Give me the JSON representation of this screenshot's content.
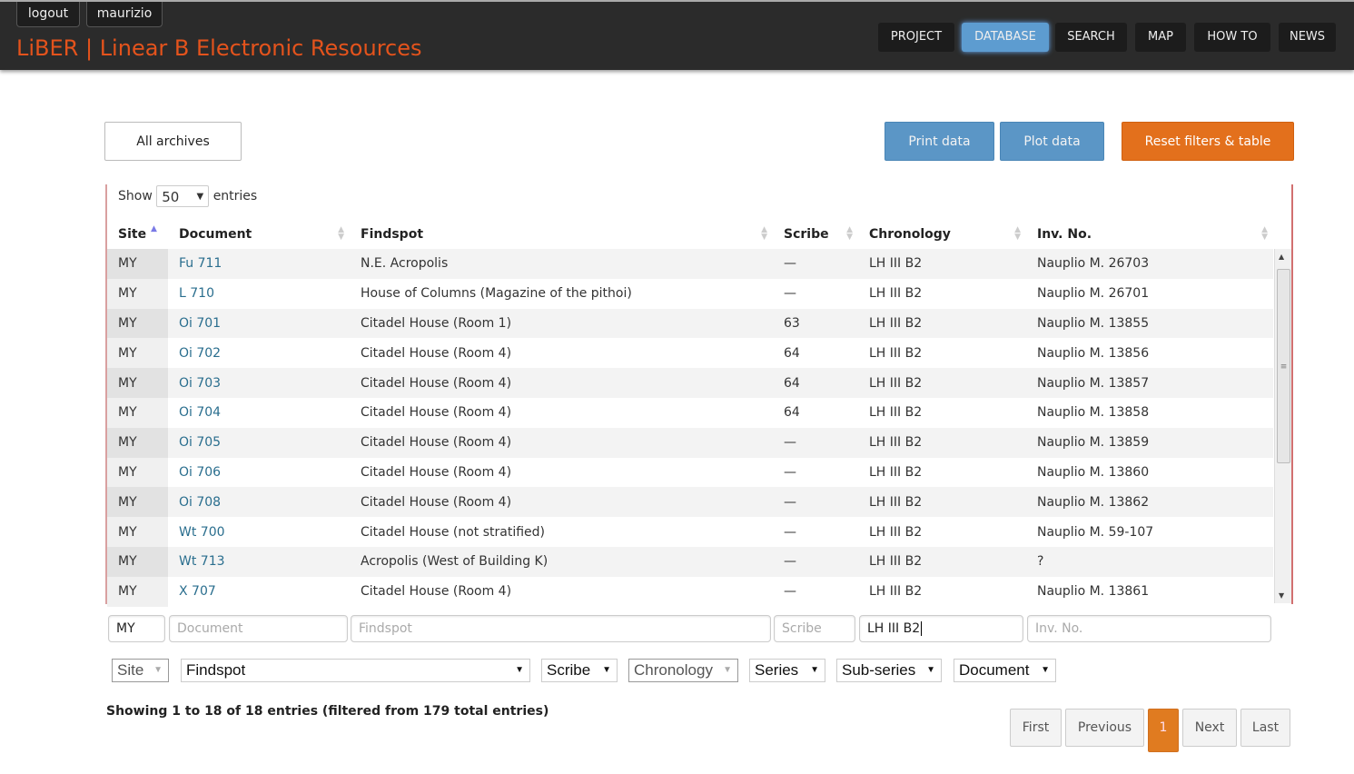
{
  "header": {
    "logout": "logout",
    "user": "maurizio",
    "brand": "LiBER | Linear B Electronic Resources",
    "nav": [
      "PROJECT",
      "DATABASE",
      "SEARCH",
      "MAP",
      "HOW TO",
      "NEWS"
    ],
    "active": "DATABASE"
  },
  "toolbar": {
    "all_archives": "All archives",
    "print": "Print data",
    "plot": "Plot data",
    "reset": "Reset filters & table"
  },
  "length": {
    "show": "Show",
    "value": "50",
    "entries": "entries"
  },
  "table": {
    "columns": [
      "Site",
      "Document",
      "Findspot",
      "Scribe",
      "Chronology",
      "Inv. No."
    ],
    "sorted_column": "Site",
    "sort_direction": "ascending",
    "rows": [
      [
        "MY",
        "Fu 711",
        "N.E. Acropolis",
        "—",
        "LH III B2",
        "Nauplio M. 26703"
      ],
      [
        "MY",
        "L 710",
        "House of Columns (Magazine of the pithoi)",
        "—",
        "LH III B2",
        "Nauplio M. 26701"
      ],
      [
        "MY",
        "Oi 701",
        "Citadel House (Room 1)",
        "63",
        "LH III B2",
        "Nauplio M. 13855"
      ],
      [
        "MY",
        "Oi 702",
        "Citadel House (Room 4)",
        "64",
        "LH III B2",
        "Nauplio M. 13856"
      ],
      [
        "MY",
        "Oi 703",
        "Citadel House (Room 4)",
        "64",
        "LH III B2",
        "Nauplio M. 13857"
      ],
      [
        "MY",
        "Oi 704",
        "Citadel House (Room 4)",
        "64",
        "LH III B2",
        "Nauplio M. 13858"
      ],
      [
        "MY",
        "Oi 705",
        "Citadel House (Room 4)",
        "—",
        "LH III B2",
        "Nauplio M. 13859"
      ],
      [
        "MY",
        "Oi 706",
        "Citadel House (Room 4)",
        "—",
        "LH III B2",
        "Nauplio M. 13860"
      ],
      [
        "MY",
        "Oi 708",
        "Citadel House (Room 4)",
        "—",
        "LH III B2",
        "Nauplio M. 13862"
      ],
      [
        "MY",
        "Wt 700",
        "Citadel House (not stratified)",
        "—",
        "LH III B2",
        "Nauplio M. 59-107"
      ],
      [
        "MY",
        "Wt 713",
        "Acropolis (West of Building K)",
        "—",
        "LH III B2",
        "?"
      ],
      [
        "MY",
        "X 707",
        "Citadel House (Room 4)",
        "—",
        "LH III B2",
        "Nauplio M. 13861"
      ]
    ]
  },
  "filters": {
    "site": "MY",
    "document_ph": "Document",
    "findspot_ph": "Findspot",
    "scribe_ph": "Scribe",
    "chronology": "LH III B2",
    "inv_ph": "Inv. No."
  },
  "dropdowns": [
    "Site",
    "Findspot",
    "Scribe",
    "Chronology",
    "Series",
    "Sub-series",
    "Document"
  ],
  "info": "Showing 1 to 18 of 18 entries (filtered from 179 total entries)",
  "pagination": {
    "first": "First",
    "previous": "Previous",
    "current": "1",
    "next": "Next",
    "last": "Last"
  },
  "colors": {
    "brand": "#e4531c",
    "accent_blue": "#5b96c6",
    "accent_orange": "#e3701c",
    "link": "#2a6e8e"
  }
}
